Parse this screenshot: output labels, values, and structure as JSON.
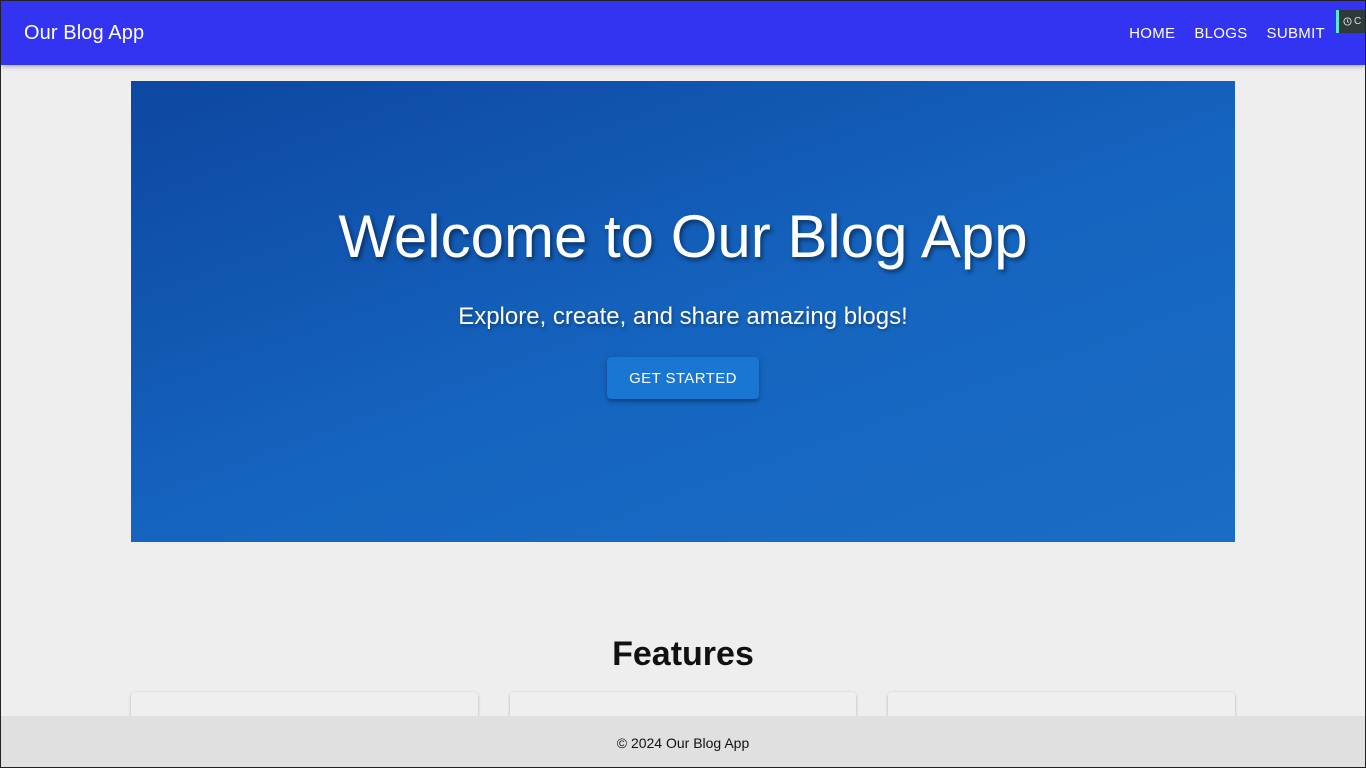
{
  "appbar": {
    "brand": "Our Blog App",
    "nav": [
      "HOME",
      "BLOGS",
      "SUBMIT"
    ],
    "color": "#3333f2"
  },
  "corner_widget": {
    "icon": "clock-icon",
    "label": "C"
  },
  "hero": {
    "title": "Welcome to Our Blog App",
    "subtitle": "Explore, create, and share amazing blogs!",
    "button": "GET STARTED",
    "color": "#1565c0"
  },
  "features": {
    "heading": "Features",
    "cards": [
      {},
      {},
      {}
    ]
  },
  "footer": {
    "text": "© 2024 Our Blog App"
  }
}
